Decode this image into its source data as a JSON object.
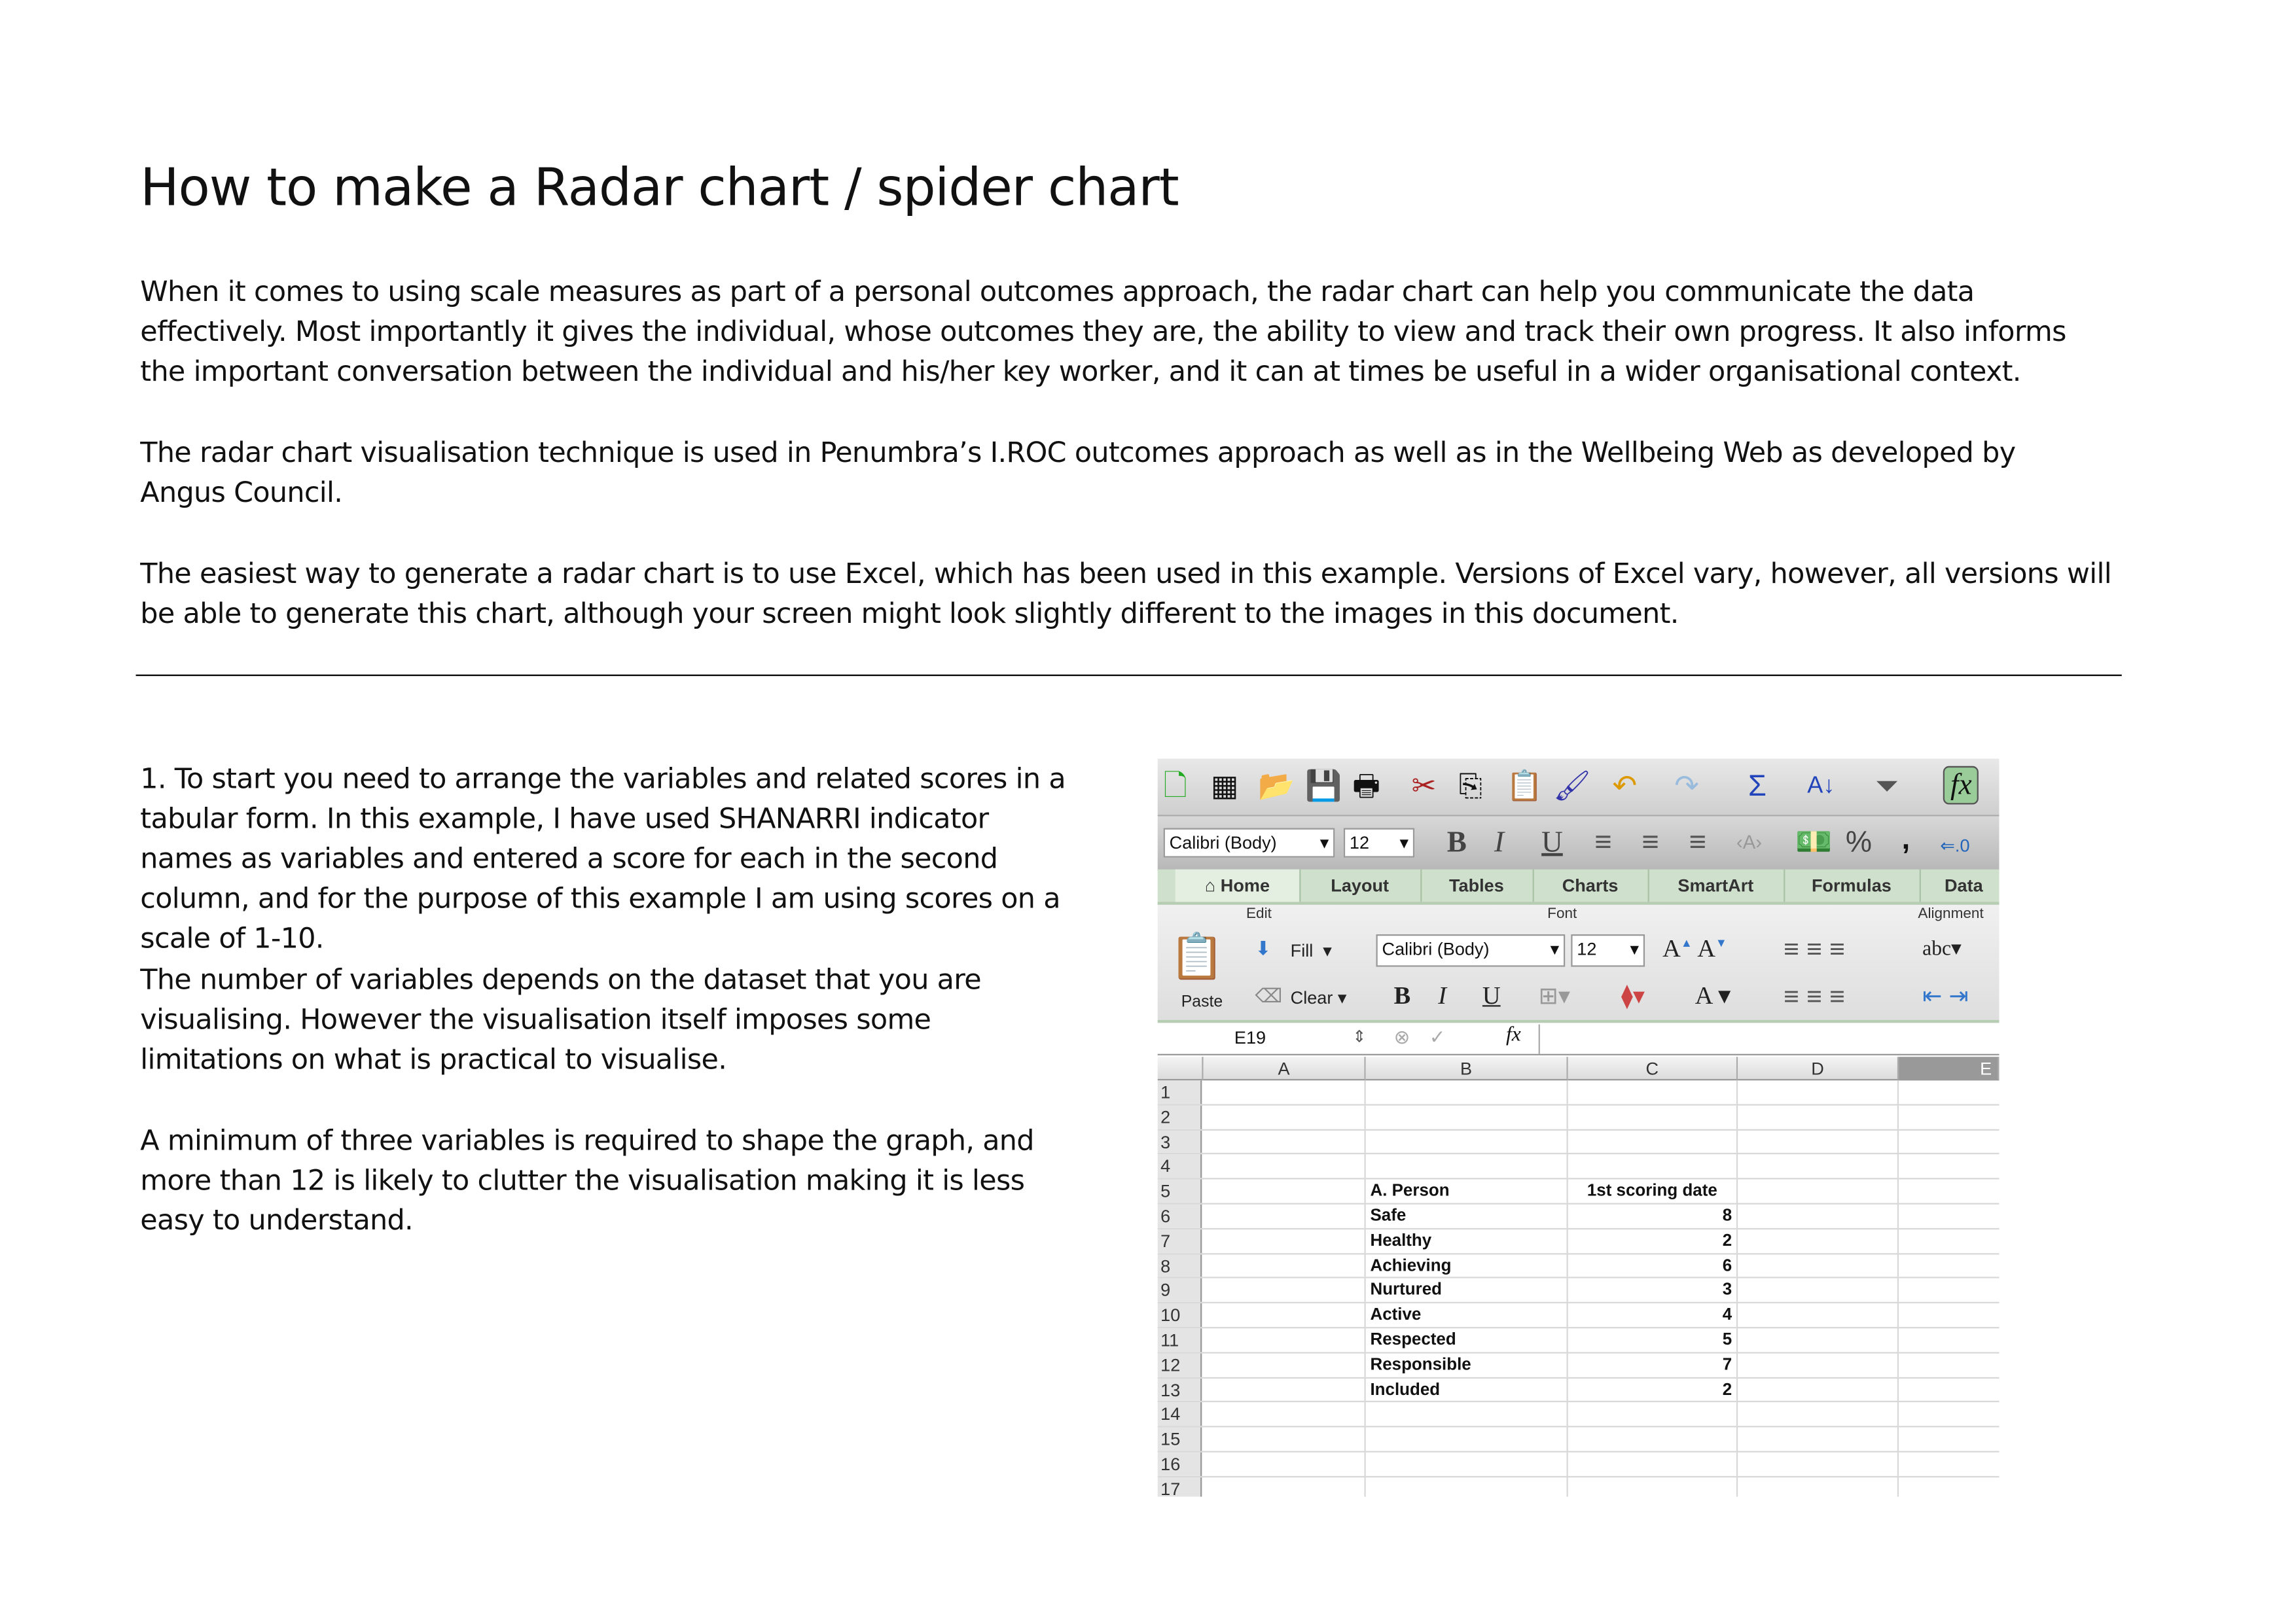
{
  "title": "How to make a Radar chart / spider chart",
  "intro": [
    "When it comes to using scale measures as part of a personal outcomes approach, the radar chart can help you communicate the data effectively. Most importantly it gives the individual, whose outcomes they are, the ability to view and track their own progress. It also informs the important conversation between the individual and his/her key worker, and it can at times be useful in a wider organisational context.",
    "The radar chart visualisation technique is used in Penumbra’s I.ROC outcomes approach as well as in the Wellbeing Web as developed by Angus Council.",
    "The easiest way to generate a radar chart is to use Excel, which has been used in this example.  Versions of Excel vary, however, all versions will be able to generate this chart, although your screen might look slightly different to the images in this document."
  ],
  "step1": [
    "1. To start you need to arrange the variables and related scores in a tabular form. In this example, I have used SHANARRI indicator names as variables and entered a score for each in the second column, and for the purpose of this example I am using scores on a scale of 1-10.",
    "The number of variables depends on the dataset that you are visualising. However the visualisation itself imposes some limitations on what is practical to visualise.",
    "A minimum of three variables is required to shape the graph, and more than 12 is likely to clutter the visualisation making it is less easy to understand."
  ],
  "excel": {
    "toolbar_font": "Calibri (Body)",
    "toolbar_size": "12",
    "tabs": [
      "Home",
      "Layout",
      "Tables",
      "Charts",
      "SmartArt",
      "Formulas",
      "Data"
    ],
    "groups": {
      "edit": "Edit",
      "font": "Font",
      "alignment": "Alignment"
    },
    "fill": "Fill",
    "clear": "Clear",
    "paste": "Paste",
    "wrap": "abc",
    "ribbon_font": "Calibri (Body)",
    "ribbon_size": "12",
    "name_box": "E19",
    "fx": "fx",
    "columns": [
      "A",
      "B",
      "C",
      "D",
      "E"
    ],
    "rows": [
      {
        "n": "1",
        "b": "",
        "c": ""
      },
      {
        "n": "2",
        "b": "",
        "c": ""
      },
      {
        "n": "3",
        "b": "",
        "c": ""
      },
      {
        "n": "4",
        "b": "",
        "c": ""
      },
      {
        "n": "5",
        "b": "A. Person",
        "c": "1st scoring date"
      },
      {
        "n": "6",
        "b": "Safe",
        "c": "8"
      },
      {
        "n": "7",
        "b": "Healthy",
        "c": "2"
      },
      {
        "n": "8",
        "b": "Achieving",
        "c": "6"
      },
      {
        "n": "9",
        "b": "Nurtured",
        "c": "3"
      },
      {
        "n": "10",
        "b": "Active",
        "c": "4"
      },
      {
        "n": "11",
        "b": "Respected",
        "c": "5"
      },
      {
        "n": "12",
        "b": "Responsible",
        "c": "7"
      },
      {
        "n": "13",
        "b": "Included",
        "c": "2"
      },
      {
        "n": "14",
        "b": "",
        "c": ""
      },
      {
        "n": "15",
        "b": "",
        "c": ""
      },
      {
        "n": "16",
        "b": "",
        "c": ""
      },
      {
        "n": "17",
        "b": "",
        "c": ""
      }
    ]
  }
}
